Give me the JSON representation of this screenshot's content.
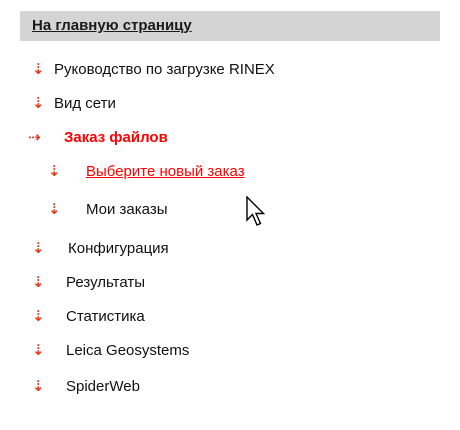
{
  "header": {
    "label": "На главную страницу"
  },
  "menu": [
    {
      "label": "Руководство по загрузке RINEX",
      "icon": "down-arrow-icon"
    },
    {
      "label": "Вид сети",
      "icon": "down-arrow-icon"
    },
    {
      "label": "Заказ файлов",
      "icon": "right-arrow-icon"
    },
    {
      "label": "Выберите новый заказ",
      "icon": "down-arrow-icon"
    },
    {
      "label": "Мои заказы",
      "icon": "down-arrow-icon"
    },
    {
      "label": "Конфигурация",
      "icon": "down-arrow-icon"
    },
    {
      "label": "Результаты",
      "icon": "down-arrow-icon"
    },
    {
      "label": "Статистика",
      "icon": "down-arrow-icon"
    },
    {
      "label": "Leica Geosystems",
      "icon": "down-arrow-icon"
    },
    {
      "label": "SpiderWeb",
      "icon": "down-arrow-icon"
    }
  ],
  "colors": {
    "header_bg": "#d4d4d4",
    "accent": "#ff0000",
    "icon": "#e63a1e"
  }
}
